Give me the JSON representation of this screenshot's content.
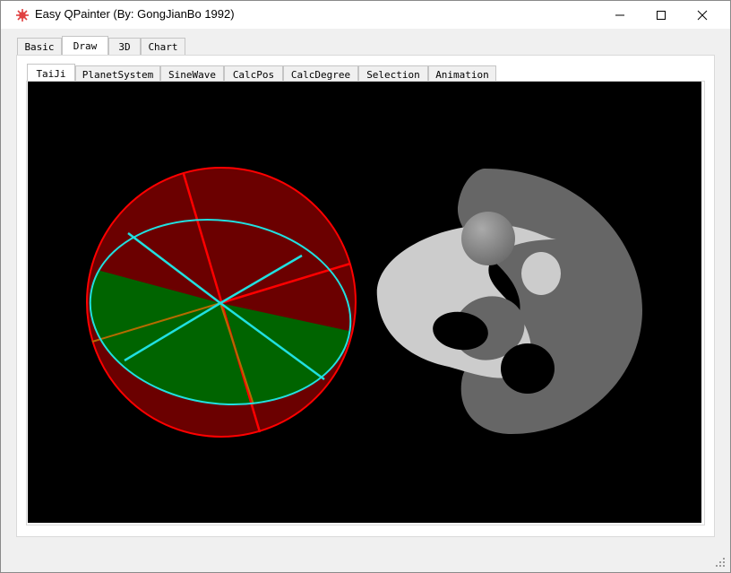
{
  "window": {
    "title": "Easy QPainter (By: GongJianBo 1992)",
    "controls": {
      "minimize": "minimize-icon",
      "maximize": "maximize-icon",
      "close": "close-icon"
    }
  },
  "top_tabs": [
    "Basic",
    "Draw",
    "3D",
    "Chart"
  ],
  "top_tab_active": "Draw",
  "sub_tabs": [
    "TaiJi",
    "PlanetSystem",
    "SineWave",
    "CalcPos",
    "CalcDegree",
    "Selection",
    "Animation"
  ],
  "sub_tab_active": "TaiJi",
  "scene": {
    "background": "#000000",
    "cylinder_colors": {
      "outline": "#ff0000",
      "top_red": "#6b0000",
      "top_green": "#006400",
      "rim": "#20e0e0",
      "orange": "#b36b00"
    },
    "taiji_colors": {
      "light": "#cccccc",
      "dark": "#666666",
      "ball": "#8c8c8c"
    }
  }
}
